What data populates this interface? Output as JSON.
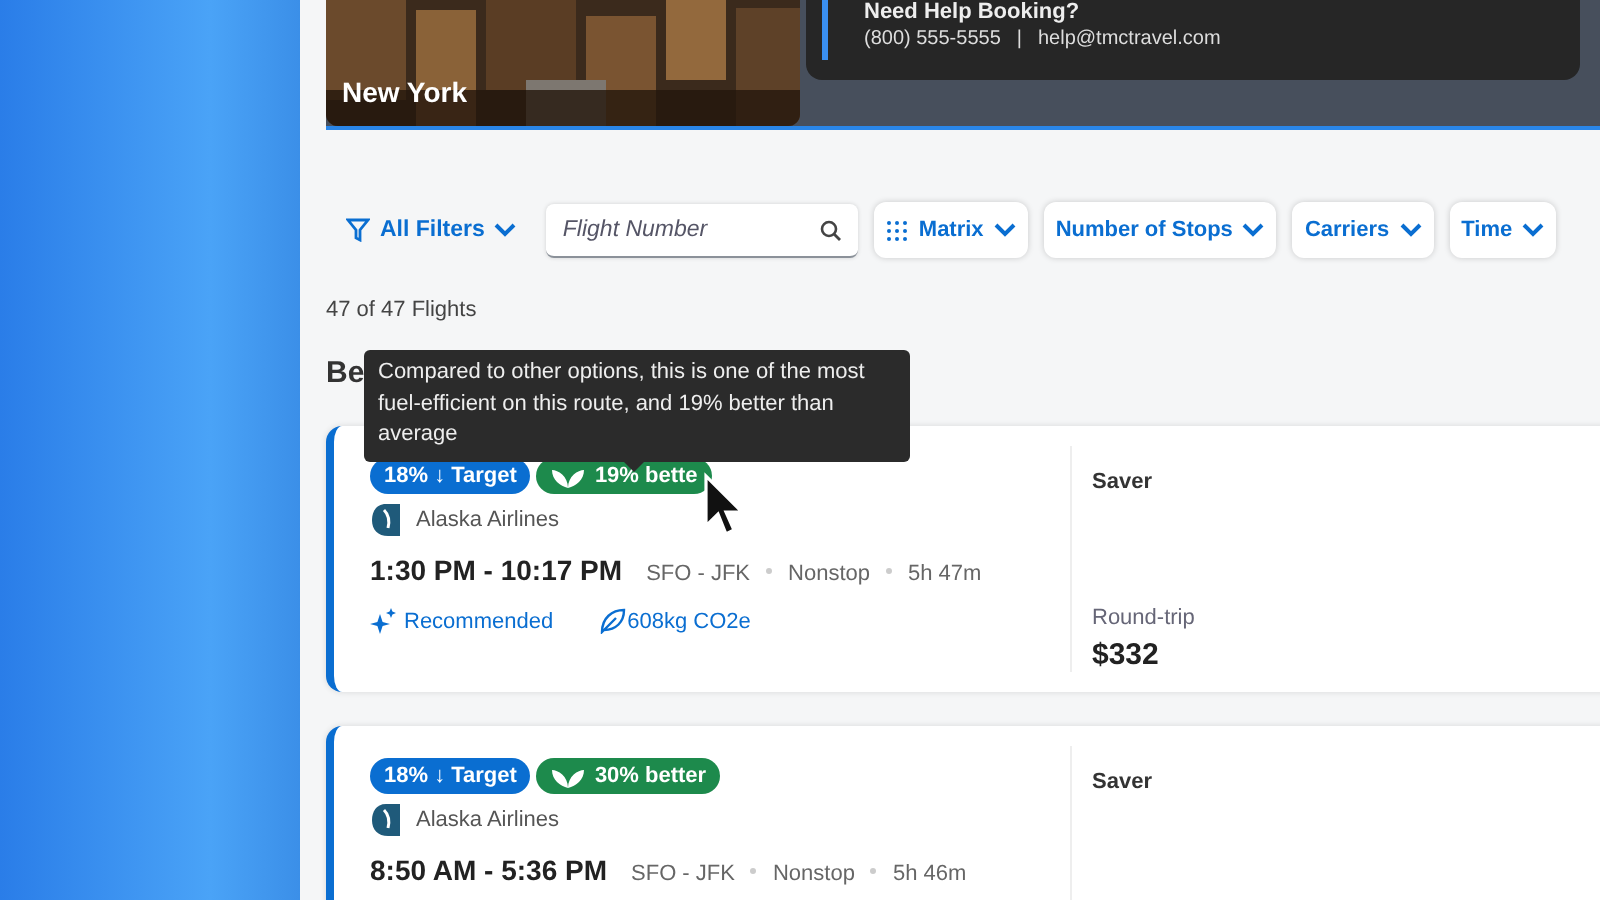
{
  "destination": {
    "city": "New York"
  },
  "help": {
    "title": "Need Help Booking?",
    "phone": "(800) 555-5555",
    "separator": "|",
    "email": "help@tmctravel.com"
  },
  "filters": {
    "all_filters": "All Filters",
    "search": {
      "placeholder": "Flight Number"
    },
    "chips": [
      {
        "label": "Matrix",
        "kind": "grid"
      },
      {
        "label": "Number of Stops",
        "kind": "plain"
      },
      {
        "label": "Carriers",
        "kind": "plain"
      },
      {
        "label": "Time",
        "kind": "plain"
      }
    ]
  },
  "result_count": "47 of 47 Flights",
  "section_heading": "Be",
  "tooltip": "Compared to other options, this is one of the most fuel-efficient on this route, and 19% better than average",
  "flights": [
    {
      "target": "18% ↓ Target",
      "eco": "19% bette",
      "airline": "Alaska Airlines",
      "times": "1:30 PM - 10:17 PM",
      "route": "SFO - JFK",
      "stops": "Nonstop",
      "duration": "5h 47m",
      "recommended": "Recommended",
      "emissions": "608kg CO2e",
      "fare": {
        "name": "Saver",
        "trip": "Round-trip",
        "price": "$332"
      }
    },
    {
      "target": "18% ↓ Target",
      "eco": "30% better",
      "airline": "Alaska Airlines",
      "times": "8:50 AM - 5:36 PM",
      "route": "SFO - JFK",
      "stops": "Nonstop",
      "duration": "5h 46m",
      "fare": {
        "name": "Saver"
      }
    }
  ]
}
